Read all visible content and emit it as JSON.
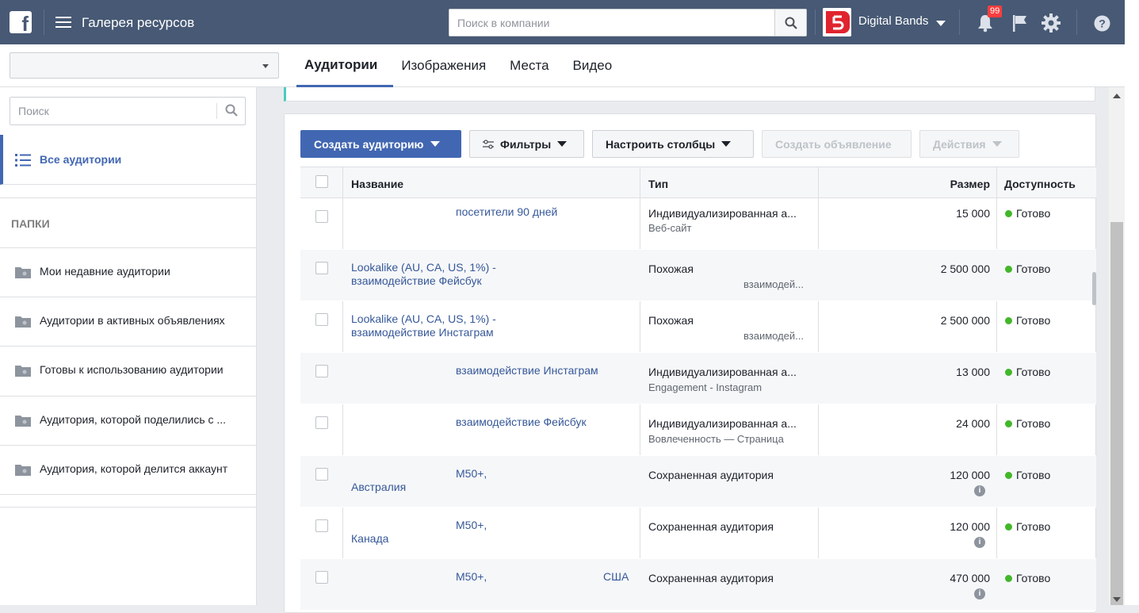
{
  "topbar": {
    "app_title": "Галерея ресурсов",
    "search_placeholder": "Поиск в компании",
    "brand_name": "Digital Bands",
    "notifications_count": "99",
    "icons": [
      "facebook-logo-icon",
      "menu-icon",
      "search-icon",
      "bell-icon",
      "flag-icon",
      "gear-icon",
      "help-icon"
    ]
  },
  "tabs": [
    {
      "label": "Аудитории",
      "active": true
    },
    {
      "label": "Изображения",
      "active": false
    },
    {
      "label": "Места",
      "active": false
    },
    {
      "label": "Видео",
      "active": false
    }
  ],
  "sidebar": {
    "search_placeholder": "Поиск",
    "all_audiences": "Все аудитории",
    "folders_heading": "ПАПКИ",
    "folders": [
      "Мои недавние аудитории",
      "Аудитории в активных объявлениях",
      "Готовы к использованию аудитории",
      "Аудитория, которой поделились с ...",
      "Аудитория, которой делится аккаунт"
    ]
  },
  "toolbar": {
    "create_audience": "Создать аудиторию",
    "filters": "Фильтры",
    "configure_columns": "Настроить столбцы",
    "create_ad": "Создать объявление",
    "actions": "Действия"
  },
  "table": {
    "headers": {
      "name": "Название",
      "type": "Тип",
      "size": "Размер",
      "availability": "Доступность"
    },
    "rows": [
      {
        "name1": "посетители 90 дней",
        "name2": "",
        "type": "Индивидуализированная а...",
        "subtype": "Веб-сайт",
        "size": "15 000",
        "status": "Готово"
      },
      {
        "name1": "Lookalike (AU, CA, US, 1%) -",
        "name2": "взаимодействие Фейсбук",
        "type": "Похожая",
        "subtype": "взаимодей...",
        "size": "2 500 000",
        "status": "Готово"
      },
      {
        "name1": "Lookalike (AU, CA, US, 1%) -",
        "name2": "взаимодействие Инстаграм",
        "type": "Похожая",
        "subtype": "взаимодей...",
        "size": "2 500 000",
        "status": "Готово"
      },
      {
        "name1": "взаимодействие Инстаграм",
        "name2": "",
        "type": "Индивидуализированная а...",
        "subtype": "Engagement - Instagram",
        "size": "13 000",
        "status": "Готово"
      },
      {
        "name1": "взаимодействие Фейсбук",
        "name2": "",
        "type": "Индивидуализированная а...",
        "subtype": "Вовлеченность — Страница",
        "size": "24 000",
        "status": "Готово"
      },
      {
        "name1": "M50+,",
        "name2": "Австралия",
        "type": "Сохраненная аудитория",
        "subtype": "",
        "size": "120 000",
        "status": "Готово"
      },
      {
        "name1": "M50+,",
        "name2": "Канада",
        "type": "Сохраненная аудитория",
        "subtype": "",
        "size": "120 000",
        "status": "Готово"
      },
      {
        "name1": "M50+,",
        "name2": "США",
        "type": "Сохраненная аудитория",
        "subtype": "",
        "size": "470 000",
        "status": "Готово"
      }
    ]
  },
  "colors": {
    "topbar": "#475974",
    "accent": "#4267b2",
    "link": "#365899",
    "ready": "#42b72a"
  }
}
